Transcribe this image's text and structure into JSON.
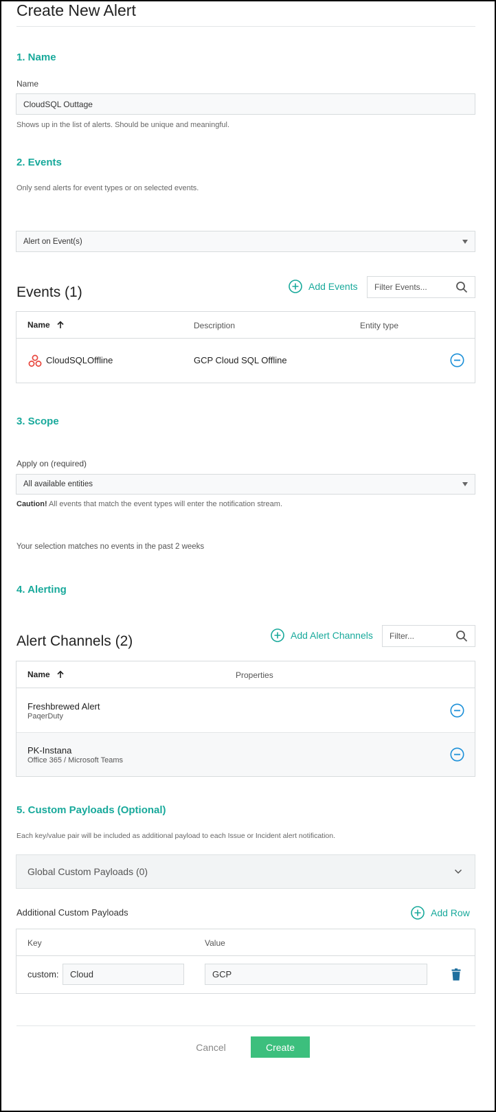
{
  "page": {
    "title": "Create New Alert"
  },
  "section_name": {
    "heading": "1. Name",
    "field_label": "Name",
    "value": "CloudSQL Outtage",
    "hint": "Shows up in the list of alerts. Should be unique and meaningful."
  },
  "section_events": {
    "heading": "2. Events",
    "description": "Only send alerts for event types or on selected events.",
    "mode_selected": "Alert on Event(s)",
    "table_title": "Events (1)",
    "add_label": "Add Events",
    "filter_placeholder": "Filter Events...",
    "columns": {
      "name": "Name",
      "description": "Description",
      "entity_type": "Entity type"
    },
    "rows": [
      {
        "name": "CloudSQLOffline",
        "description": "GCP Cloud SQL Offline",
        "entity_type": ""
      }
    ]
  },
  "section_scope": {
    "heading": "3. Scope",
    "apply_label": "Apply on (required)",
    "apply_selected": "All available entities",
    "caution_strong": "Caution!",
    "caution_text": " All events that match the event types will enter the notification stream.",
    "match_text": "Your selection matches no events in the past 2 weeks"
  },
  "section_alerting": {
    "heading": "4. Alerting",
    "table_title": "Alert Channels (2)",
    "add_label": "Add Alert Channels",
    "filter_placeholder": "Filter...",
    "columns": {
      "name": "Name",
      "properties": "Properties"
    },
    "rows": [
      {
        "name": "Freshbrewed Alert",
        "type": "PaqerDuty"
      },
      {
        "name": "PK-Instana",
        "type": "Office 365 / Microsoft Teams"
      }
    ]
  },
  "section_payloads": {
    "heading": "5. Custom Payloads (Optional)",
    "description": "Each key/value pair will be included as additional payload to each Issue or Incident alert notification.",
    "global_label": "Global Custom Payloads (0)",
    "additional_label": "Additional Custom Payloads",
    "add_row_label": "Add Row",
    "columns": {
      "key": "Key",
      "value": "Value"
    },
    "rows": [
      {
        "prefix": "custom:",
        "key": "Cloud",
        "value": "GCP"
      }
    ]
  },
  "footer": {
    "cancel_label": "Cancel",
    "create_label": "Create"
  },
  "colors": {
    "accent": "#18a99b",
    "primary_button": "#3cbf7d",
    "remove_icon": "#1a8fd8",
    "delete_icon": "#1f6f9e",
    "event_icon": "#e8453c"
  }
}
